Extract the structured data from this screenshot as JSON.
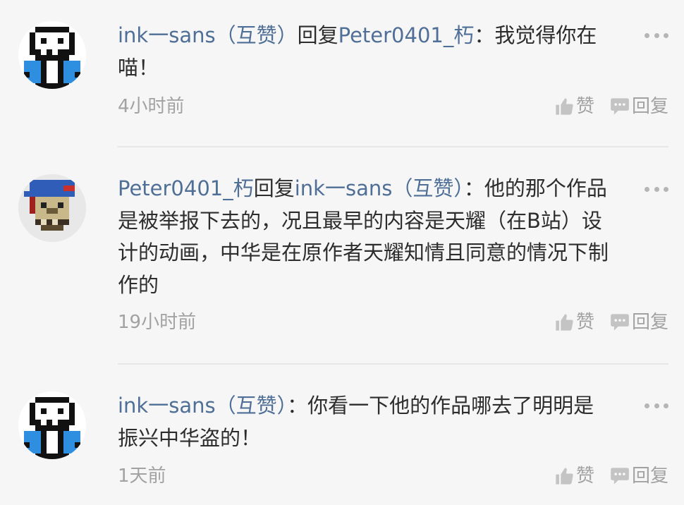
{
  "comments": [
    {
      "author": "ink一sans（互赞）",
      "reply_word": "回复",
      "reply_to": "Peter0401_朽",
      "separator": "：",
      "content": "我觉得你在喵！",
      "time": "4小时前",
      "like_label": "赞",
      "reply_label": "回复",
      "avatar_icon": "pixel-skeleton-avatar"
    },
    {
      "author": "Peter0401_朽",
      "reply_word": "回复",
      "reply_to": "ink一sans（互赞）",
      "separator": "：",
      "content": "他的那个作品是被举报下去的，况且最早的内容是天耀（在B站）设计的动画，中华是在原作者天耀知情且同意的情况下制作的",
      "time": "19小时前",
      "like_label": "赞",
      "reply_label": "回复",
      "avatar_icon": "pixel-pirate-skull-avatar"
    },
    {
      "author": "ink一sans（互赞）",
      "reply_word": "",
      "reply_to": "",
      "separator": "：",
      "content": "你看一下他的作品哪去了明明是振兴中华盗的！",
      "time": "1天前",
      "like_label": "赞",
      "reply_label": "回复",
      "avatar_icon": "pixel-skeleton-avatar"
    }
  ],
  "colors": {
    "background": "#f6f6f6",
    "username": "#4f6f97",
    "body_text": "#2d2d2d",
    "meta": "#a2a2a2"
  }
}
